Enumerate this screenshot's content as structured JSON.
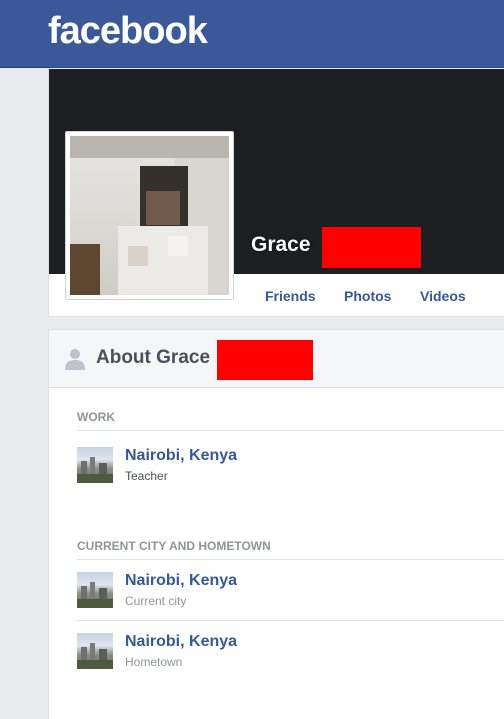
{
  "header": {
    "logo": "facebook"
  },
  "profile": {
    "first_name": "Grace",
    "tabs": [
      "Friends",
      "Photos",
      "Videos"
    ]
  },
  "about": {
    "title": "About Grace",
    "sections": [
      {
        "label": "WORK",
        "entries": [
          {
            "title": "Nairobi, Kenya",
            "subtitle": "Teacher"
          }
        ]
      },
      {
        "label": "CURRENT CITY AND HOMETOWN",
        "entries": [
          {
            "title": "Nairobi, Kenya",
            "subtitle": "Current city"
          },
          {
            "title": "Nairobi, Kenya",
            "subtitle": "Hometown"
          }
        ]
      }
    ]
  },
  "colors": {
    "brand": "#3b5998",
    "link": "#365899",
    "redaction": "#ff0000"
  },
  "icons": {
    "about": "person-icon",
    "place": "city-thumbnail"
  }
}
